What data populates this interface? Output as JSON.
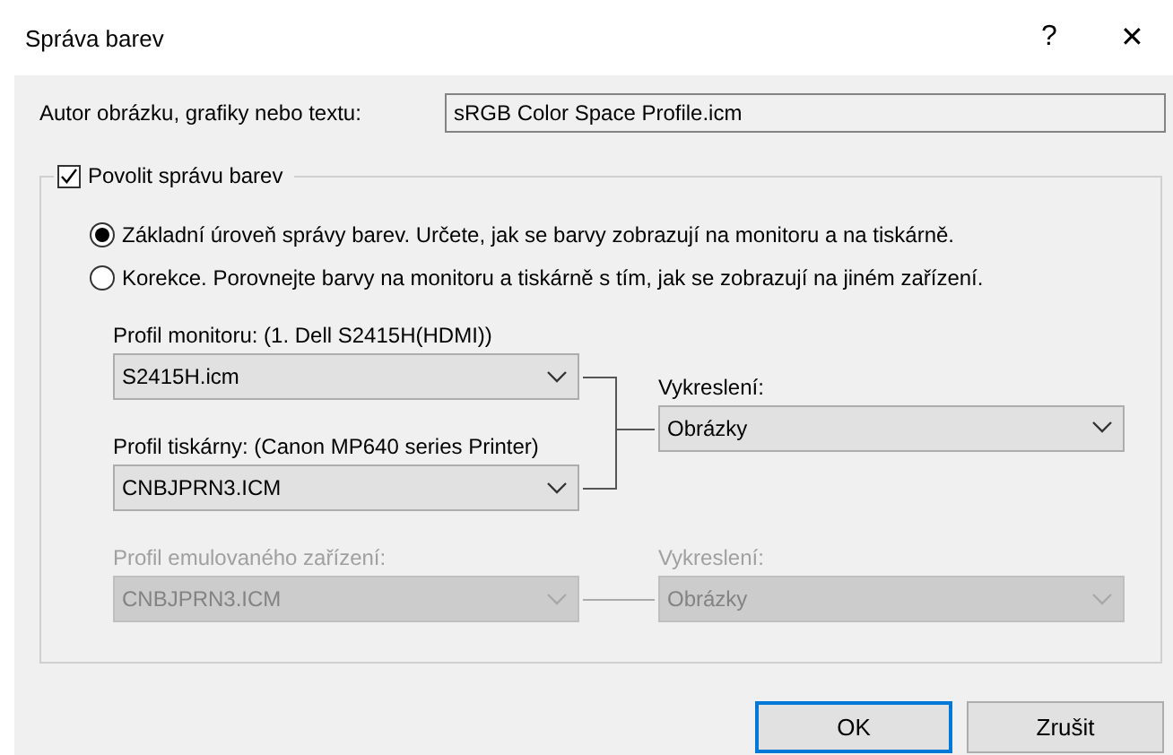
{
  "window": {
    "title": "Správa barev",
    "help": "?",
    "close": "✕"
  },
  "author": {
    "label": "Autor obrázku, grafiky nebo textu:",
    "value": "sRGB Color Space Profile.icm"
  },
  "group": {
    "label": "Povolit správu barev",
    "checked": true
  },
  "radios": [
    {
      "label": "Základní úroveň správy barev. Určete, jak se barvy zobrazují na monitoru a na tiskárně.",
      "selected": true
    },
    {
      "label": "Korekce. Porovnejte barvy na monitoru a tiskárně s tím, jak se zobrazují na jiném zařízení.",
      "selected": false
    }
  ],
  "monitor_profile": {
    "label": "Profil monitoru: (1. Dell S2415H(HDMI))",
    "value": "S2415H.icm",
    "disabled": false
  },
  "printer_profile": {
    "label": "Profil tiskárny: (Canon MP640 series Printer)",
    "value": "CNBJPRN3.ICM",
    "disabled": false
  },
  "rendering": {
    "label": "Vykreslení:",
    "value": "Obrázky",
    "disabled": false
  },
  "emulated_profile": {
    "label": "Profil emulovaného zařízení:",
    "value": "CNBJPRN3.ICM",
    "disabled": true
  },
  "emulated_rendering": {
    "label": "Vykreslení:",
    "value": "Obrázky",
    "disabled": true
  },
  "buttons": [
    {
      "label": "OK",
      "default": true
    },
    {
      "label": "Zrušit",
      "default": false
    }
  ]
}
